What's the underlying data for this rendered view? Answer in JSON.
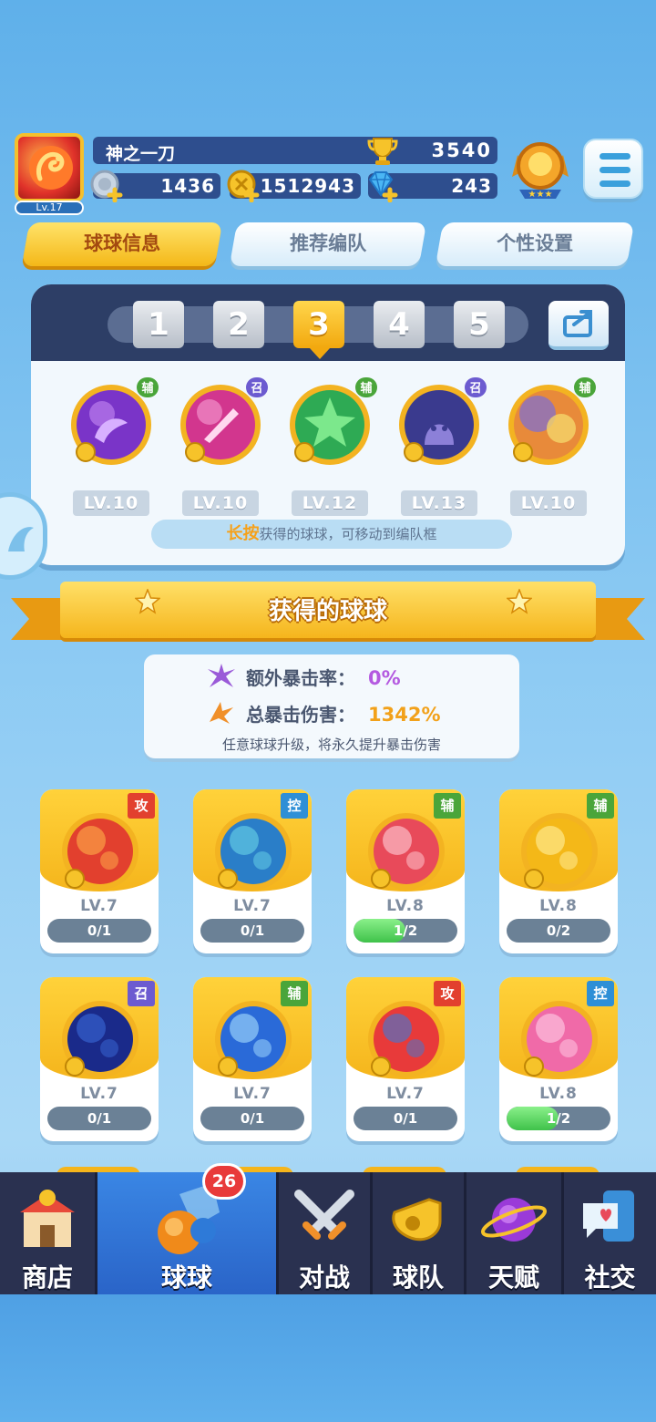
{
  "player": {
    "name": "神之一刀",
    "level": "Lv.17",
    "trophies": "3540"
  },
  "resources": {
    "silver": "1436",
    "gold": "1512943",
    "gems": "243"
  },
  "tabs": [
    "球球信息",
    "推荐编队",
    "个性设置"
  ],
  "team": {
    "slots": [
      "1",
      "2",
      "3",
      "4",
      "5"
    ],
    "active_slot": 3,
    "members": [
      {
        "tag": "辅",
        "level": "LV.10"
      },
      {
        "tag": "召",
        "level": "LV.10"
      },
      {
        "tag": "辅",
        "level": "LV.12"
      },
      {
        "tag": "召",
        "level": "LV.13"
      },
      {
        "tag": "辅",
        "level": "LV.10"
      }
    ],
    "hint_highlight": "长按",
    "hint_text": "获得的球球，可移动到编队框"
  },
  "collection": {
    "title": "获得的球球",
    "extra_crit_label": "额外暴击率：",
    "extra_crit_value": "0%",
    "total_crit_label": "总暴击伤害：",
    "total_crit_value": "1342%",
    "note": "任意球球升级，将永久提升暴击伤害"
  },
  "cards": [
    {
      "tag": "攻",
      "level": "LV.7",
      "progress": "0/1",
      "fill": 0
    },
    {
      "tag": "控",
      "level": "LV.7",
      "progress": "0/1",
      "fill": 0
    },
    {
      "tag": "辅",
      "level": "LV.8",
      "progress": "1/2",
      "fill": 0.5
    },
    {
      "tag": "辅",
      "level": "LV.8",
      "progress": "0/2",
      "fill": 0
    },
    {
      "tag": "召",
      "level": "LV.7",
      "progress": "0/1",
      "fill": 0
    },
    {
      "tag": "辅",
      "level": "LV.7",
      "progress": "0/1",
      "fill": 0
    },
    {
      "tag": "攻",
      "level": "LV.7",
      "progress": "0/1",
      "fill": 0
    },
    {
      "tag": "控",
      "level": "LV.8",
      "progress": "1/2",
      "fill": 0.5
    }
  ],
  "nav": {
    "items": [
      "商店",
      "球球",
      "对战",
      "球队",
      "天赋",
      "社交"
    ],
    "active": "球球",
    "badge": "26"
  },
  "colors": {
    "accent": "#f5b51c",
    "navbar": "#2a3150",
    "active_nav": "#2a64c8"
  }
}
